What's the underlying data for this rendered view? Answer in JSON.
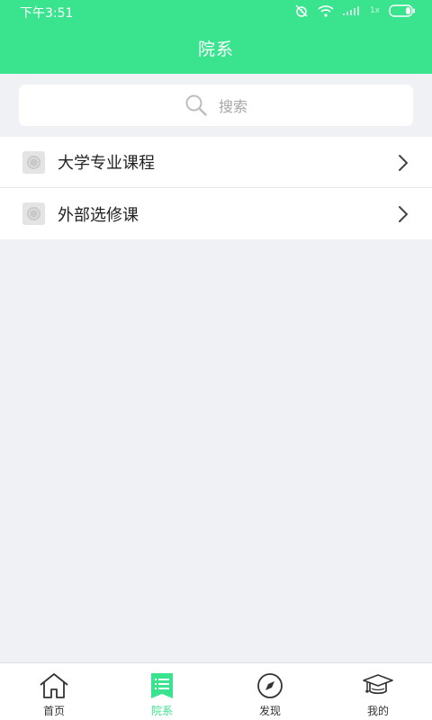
{
  "status_bar": {
    "time": "下午3:51",
    "signal_text": "1x"
  },
  "header": {
    "title": "院系"
  },
  "search": {
    "placeholder": "搜索"
  },
  "list": {
    "items": [
      {
        "label": "大学专业课程",
        "icon": "course-thumbnail-icon"
      },
      {
        "label": "外部选修课",
        "icon": "course-thumbnail-icon"
      }
    ]
  },
  "tabbar": {
    "tabs": [
      {
        "label": "首页",
        "icon": "home-icon",
        "active": false
      },
      {
        "label": "院系",
        "icon": "list-icon",
        "active": true
      },
      {
        "label": "发现",
        "icon": "compass-icon",
        "active": false
      },
      {
        "label": "我的",
        "icon": "graduation-cap-icon",
        "active": false
      }
    ]
  },
  "colors": {
    "accent": "#3ae48e",
    "background": "#eff1f4",
    "placeholder": "#a7a7a7"
  }
}
